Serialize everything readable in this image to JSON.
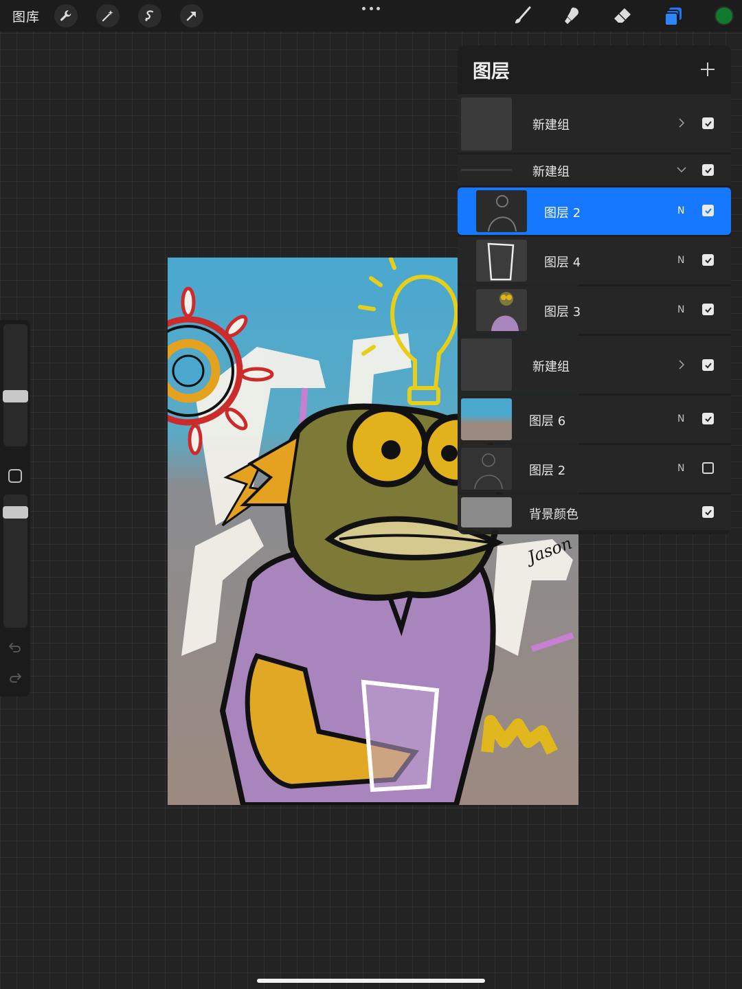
{
  "toolbar": {
    "gallery_label": "图库",
    "left_tools": [
      "wrench-icon",
      "magic-wand-icon",
      "selection-icon",
      "transform-arrow-icon"
    ],
    "right_tools": [
      "brush-icon",
      "smudge-icon",
      "eraser-icon",
      "layers-icon"
    ],
    "active_color": "#0f7a2c",
    "accent": "#1677ff"
  },
  "canvas": {
    "signature": "Jason"
  },
  "layers_panel": {
    "title": "图层",
    "layers": [
      {
        "name": "新建组",
        "type": "group",
        "expanded": false,
        "visible": true
      },
      {
        "name": "新建组",
        "type": "group",
        "expanded": true,
        "visible": true
      },
      {
        "name": "图层 2",
        "type": "layer",
        "blend": "N",
        "visible": true,
        "selected": true
      },
      {
        "name": "图层 4",
        "type": "layer",
        "blend": "N",
        "visible": true
      },
      {
        "name": "图层 3",
        "type": "layer",
        "blend": "N",
        "visible": true
      },
      {
        "name": "新建组",
        "type": "group",
        "expanded": false,
        "visible": true
      },
      {
        "name": "图层 6",
        "type": "layer",
        "blend": "N",
        "visible": true
      },
      {
        "name": "图层 2",
        "type": "layer",
        "blend": "N",
        "visible": false
      },
      {
        "name": "背景颜色",
        "type": "background",
        "visible": true
      }
    ]
  }
}
